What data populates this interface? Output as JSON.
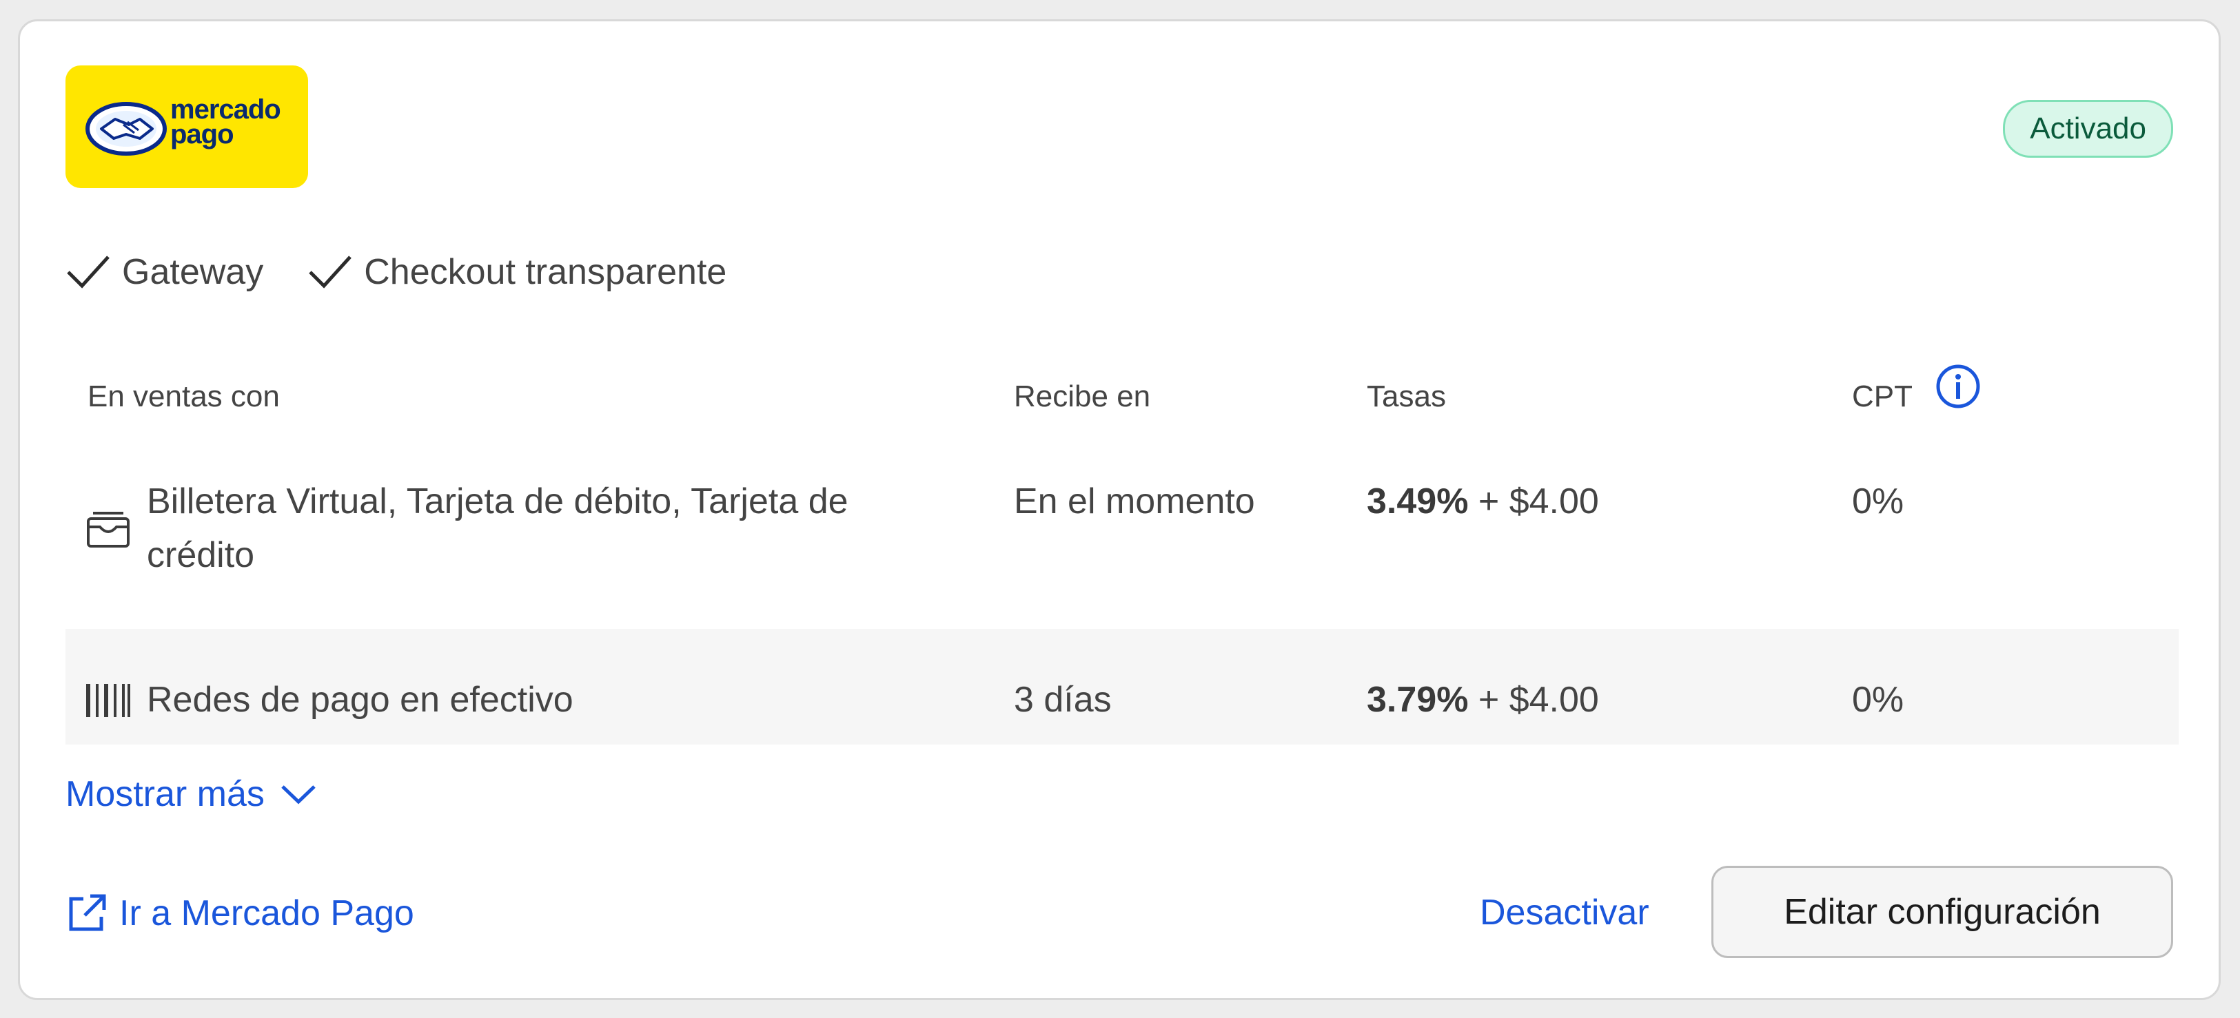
{
  "provider": {
    "logo_line1": "mercado",
    "logo_line2": "pago",
    "status": "Activado",
    "brand_color": "#ffe600"
  },
  "features": [
    "Gateway",
    "Checkout transparente"
  ],
  "table": {
    "headers": {
      "methods": "En ventas con",
      "receive": "Recibe en",
      "rates": "Tasas",
      "cpt": "CPT"
    },
    "rows": [
      {
        "icon": "wallet-icon",
        "methods_line1": "Billetera Virtual, Tarjeta de débito, Tarjeta de",
        "methods_line2": "crédito",
        "receive": "En el momento",
        "rate_percent": "3.49%",
        "rate_fixed": "+ $4.00",
        "cpt": "0%"
      },
      {
        "icon": "barcode-icon",
        "methods_line1": "Redes de pago en efectivo",
        "receive": "3 días",
        "rate_percent": "3.79%",
        "rate_fixed": "+ $4.00",
        "cpt": "0%"
      }
    ]
  },
  "actions": {
    "show_more": "Mostrar más",
    "go_to": "Ir a Mercado Pago",
    "deactivate": "Desactivar",
    "edit": "Editar configuración"
  },
  "colors": {
    "link": "#1a56db",
    "badge_bg": "#d9f7ea",
    "badge_text": "#0a5a3b"
  }
}
